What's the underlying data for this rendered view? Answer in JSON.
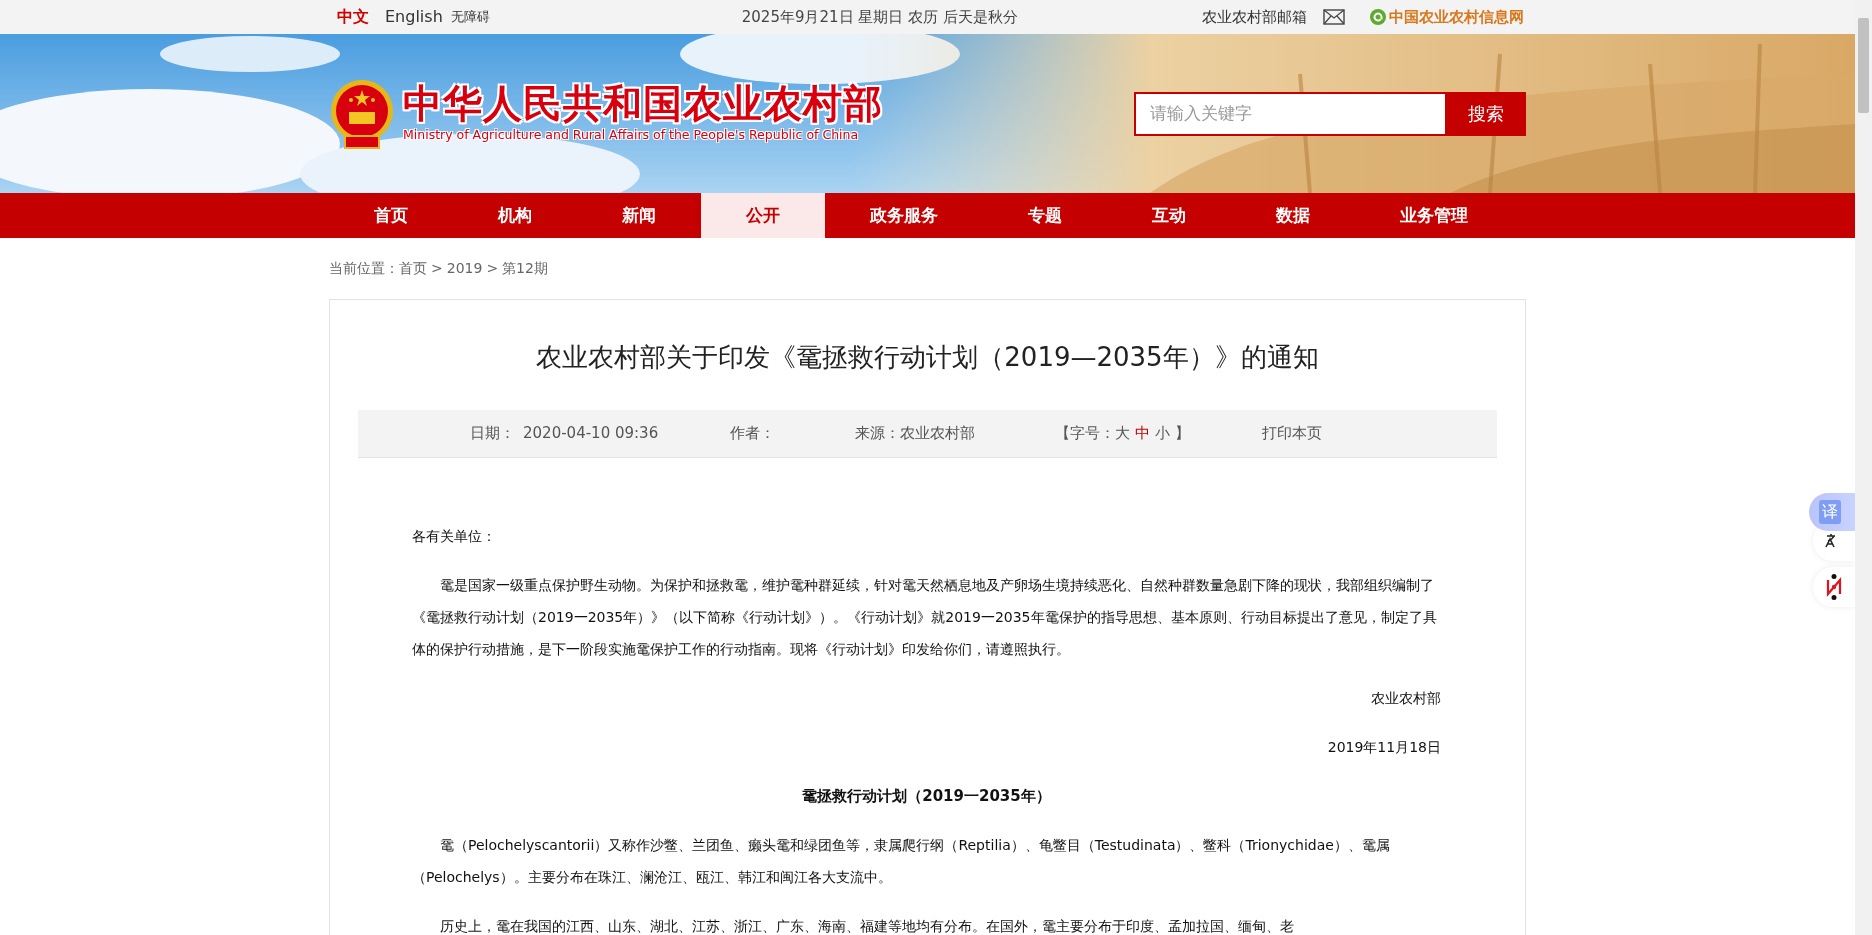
{
  "top_bar": {
    "languages": [
      {
        "label": "中文",
        "selected": true
      },
      {
        "label": "English",
        "selected": false
      }
    ],
    "accessibility": "无障碍",
    "date": "2025年9月21日 星期日 农历 后天是秋分",
    "mailbox": "农业农村部邮箱",
    "info_site": "中国农业农村信息网"
  },
  "header": {
    "title": "中华人民共和国农业农村部",
    "subtitle": "Ministry of Agriculture and Rural Affairs of the People's Republic of China",
    "search": {
      "placeholder": "请输入关键字",
      "button": "搜索"
    }
  },
  "nav": [
    {
      "label": "首页",
      "selected": false
    },
    {
      "label": "机构",
      "selected": false
    },
    {
      "label": "新闻",
      "selected": false
    },
    {
      "label": "公开",
      "selected": true
    },
    {
      "label": "政务服务",
      "selected": false
    },
    {
      "label": "专题",
      "selected": false
    },
    {
      "label": "互动",
      "selected": false
    },
    {
      "label": "数据",
      "selected": false
    },
    {
      "label": "业务管理",
      "selected": false
    }
  ],
  "breadcrumb": {
    "label": "当前位置：",
    "separator": ">",
    "items": [
      "首页",
      "2019",
      "第12期"
    ]
  },
  "article": {
    "title": "农业农村部关于印发《鼋拯救行动计划（2019—2035年）》的通知",
    "meta": {
      "date_label": "日期：",
      "date": "2020-04-10 09:36",
      "author_label": "作者：",
      "source": "来源：农业农村部",
      "font_size_open": "【字号：",
      "font_sizes": [
        {
          "label": "大",
          "selected": false
        },
        {
          "label": "中",
          "selected": true
        },
        {
          "label": "小",
          "selected": false
        }
      ],
      "font_size_close": "】",
      "print": "打印本页"
    },
    "paragraphs": [
      {
        "kind": "plain",
        "text": "各有关单位："
      },
      {
        "kind": "indent",
        "text": "鼋是国家一级重点保护野生动物。为保护和拯救鼋，维护鼋种群延续，针对鼋天然栖息地及产卵场生境持续恶化、自然种群数量急剧下降的现状，我部组织编制了《鼋拯救行动计划（2019一2035年）》（以下简称《行动计划》）。《行动计划》就2019一2035年鼋保护的指导思想、基本原则、行动目标提出了意见，制定了具体的保护行动措施，是下一阶段实施鼋保护工作的行动指南。现将《行动计划》印发给你们，请遵照执行。"
      },
      {
        "kind": "right",
        "text": "农业农村部"
      },
      {
        "kind": "right",
        "text": "2019年11月18日"
      },
      {
        "kind": "heading",
        "text": "鼋拯救行动计划（2019一2035年）"
      },
      {
        "kind": "indent",
        "text": "鼋（Pelochelyscantorii）又称作沙鳖、兰团鱼、癞头鼋和绿团鱼等，隶属爬行纲（Reptilia）、龟鳖目（Testudinata）、鳖科（Trionychidae）、鼋属（Pelochelys）。主要分布在珠江、澜沧江、瓯江、韩江和闽江各大支流中。"
      },
      {
        "kind": "indent",
        "text": "历史上，鼋在我国的江西、山东、湖北、江苏、浙江、广东、海南、福建等地均有分布。在国外，鼋主要分布于印度、孟加拉国、缅甸、老"
      }
    ]
  },
  "side_tools": {
    "translate": "译"
  }
}
